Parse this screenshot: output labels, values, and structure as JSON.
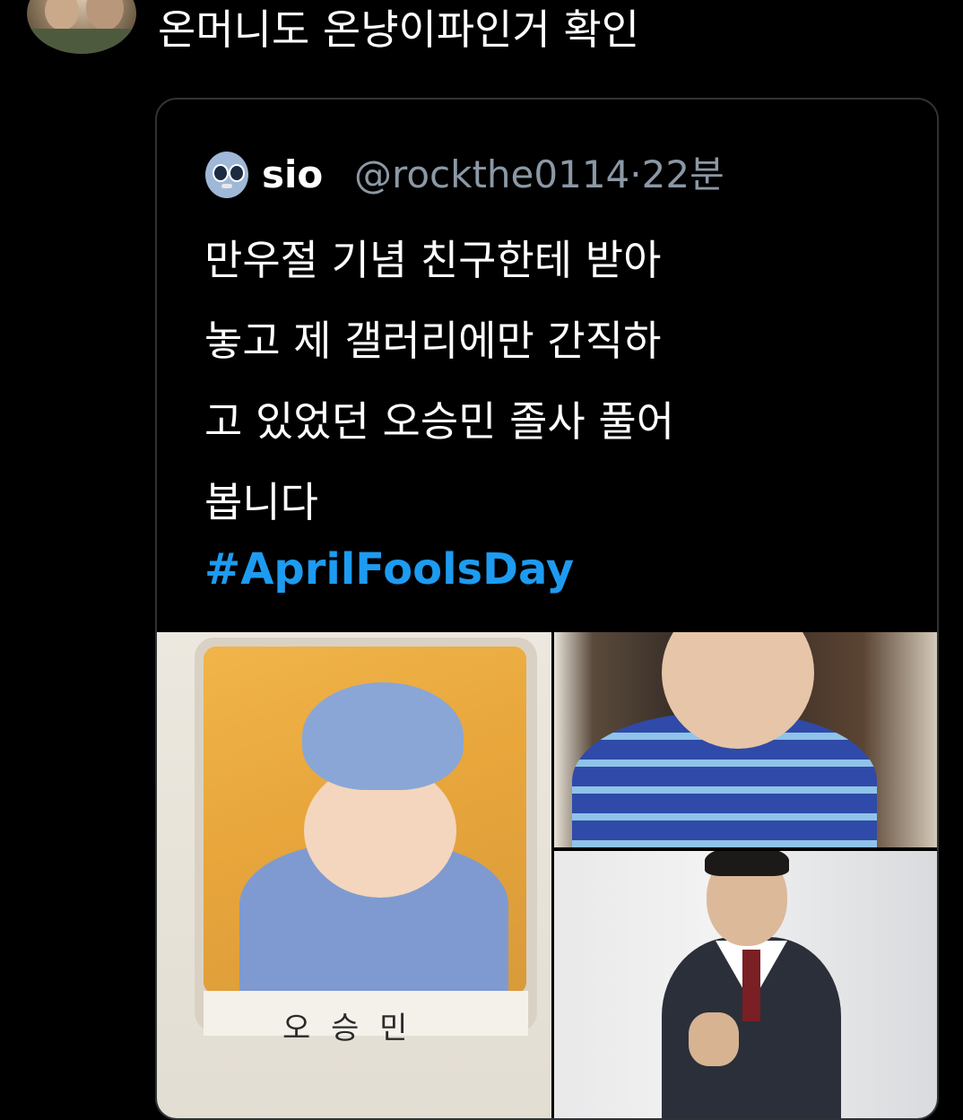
{
  "reply": {
    "text": "온머니도 온냥이파인거 확인"
  },
  "quoted_tweet": {
    "display_name": "sio",
    "handle_time": "@rockthe0114·22분",
    "body_lines": [
      "만우절 기념 친구한테 받아",
      "놓고 제 갤러리에만 간직하",
      "고 있었던 오승민 졸사 풀어",
      "봅니다"
    ],
    "hashtag": "#AprilFoolsDay",
    "photo_caption": "오 승 민"
  },
  "colors": {
    "background": "#000000",
    "text": "#ffffff",
    "muted": "#8b98a5",
    "link": "#1d9bf0",
    "card_border": "#2f3336"
  }
}
